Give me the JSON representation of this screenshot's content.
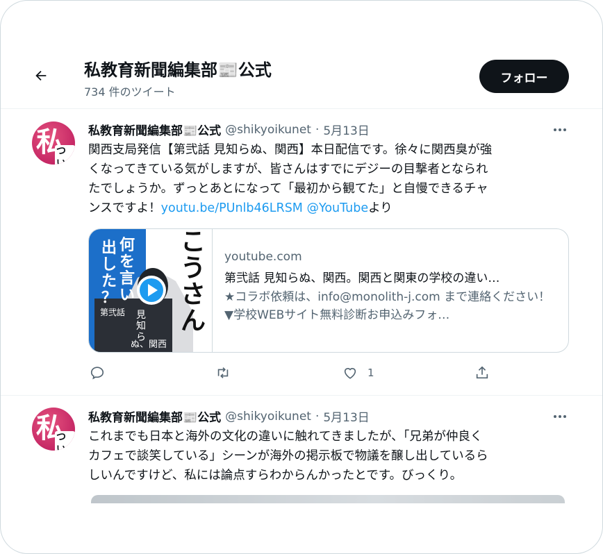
{
  "header": {
    "title": "私教育新聞編集部📰公式",
    "tweet_count": "734 件のツイート",
    "follow_label": "フォロー"
  },
  "tweets": [
    {
      "name": "私教育新聞編集部📰公式",
      "handle": "@shikyoikunet",
      "separator": "·",
      "date": "5月13日",
      "avatar_text": "私",
      "avatar_small": "ついい",
      "text_lines": [
        "関西支局発信【第弐話 見知らぬ、関西】本日配信です。徐々に関西臭が強",
        "くなってきている気がしますが、皆さんはすでにデジーの目撃者となられ",
        "たでしょうか。ずっとあとになって「最初から観てた」と自慢できるチャ"
      ],
      "text_last_prefix": "ンスですよ！",
      "link": "youtu.be/PUnlb46LRSM",
      "mention": "@YouTube",
      "text_last_suffix": "より",
      "card": {
        "domain": "youtube.com",
        "title": "第弐話 見知らぬ、関西。関西と関東の学校の違い…",
        "description": "★コラボ依頼は、info@monolith-j.com まで連絡ください！▼学校WEBサイト無料診断お申込みフォ…",
        "thumb_text": {
          "top": "こうさん。",
          "side": "何を言い出した？",
          "label_small": "第弐話",
          "label_big": "見知らぬ、関西"
        }
      },
      "likes": "1"
    },
    {
      "name": "私教育新聞編集部📰公式",
      "handle": "@shikyoikunet",
      "separator": "·",
      "date": "5月13日",
      "avatar_text": "私",
      "avatar_small": "ついい",
      "text_lines": [
        "これまでも日本と海外の文化の違いに触れてきましたが、「兄弟が仲良く",
        "カフェで談笑している」シーンが海外の掲示板で物議を醸し出しているら",
        "しいんですけど、私には論点すらわからんかったとです。びっくり。"
      ]
    }
  ],
  "icons": {
    "back": "arrow-left-icon",
    "more": "more-horizontal-icon",
    "reply": "reply-icon",
    "retweet": "retweet-icon",
    "like": "heart-icon",
    "share": "share-icon",
    "play": "play-icon"
  },
  "colors": {
    "link": "#1d9bf0",
    "text": "#0f1419",
    "secondary": "#536471",
    "follow_bg": "#0f1419",
    "avatar": "#d63a6e"
  }
}
